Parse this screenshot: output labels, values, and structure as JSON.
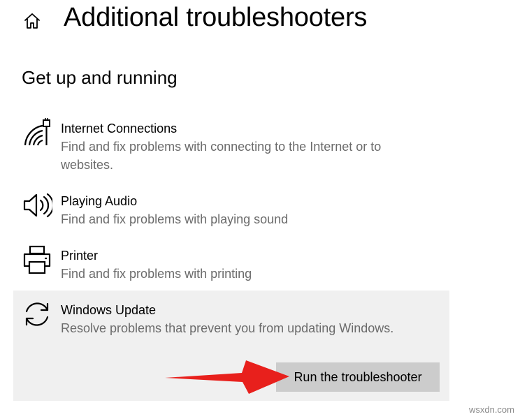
{
  "header": {
    "home_icon": "home-icon",
    "title": "Additional troubleshooters"
  },
  "section": {
    "title": "Get up and running"
  },
  "troubleshooters": [
    {
      "icon": "wifi-ethernet-icon",
      "name": "Internet Connections",
      "description": "Find and fix problems with connecting to the Internet or to websites."
    },
    {
      "icon": "speaker-icon",
      "name": "Playing Audio",
      "description": "Find and fix problems with playing sound"
    },
    {
      "icon": "printer-icon",
      "name": "Printer",
      "description": "Find and fix problems with printing"
    },
    {
      "icon": "sync-icon",
      "name": "Windows Update",
      "description": "Resolve problems that prevent you from updating Windows.",
      "selected": true
    }
  ],
  "actions": {
    "run_label": "Run the troubleshooter"
  },
  "annotation": {
    "arrow_color": "#e8201c"
  },
  "colors": {
    "background": "#ffffff",
    "selected_background": "#f0f0f0",
    "button_background": "#cccccc",
    "secondary_text": "#6b6b6b"
  },
  "watermark": "wsxdn.com"
}
